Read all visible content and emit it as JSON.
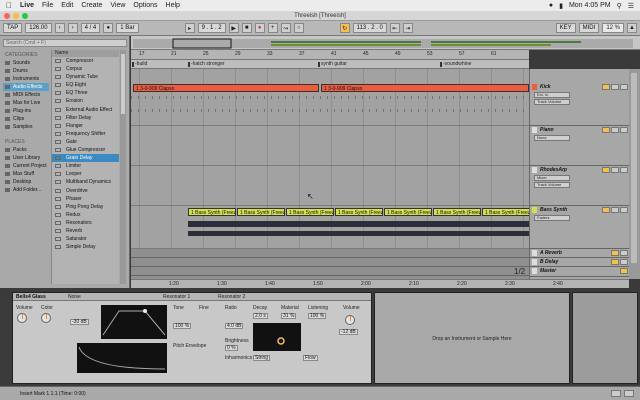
{
  "menubar": {
    "app": "Live",
    "items": [
      "File",
      "Edit",
      "Create",
      "View",
      "Options",
      "Help"
    ],
    "clock": "Mon 4:05 PM"
  },
  "window": {
    "title": "Threeish  [Threeish]"
  },
  "transport": {
    "tap": "TAP",
    "tempo": "126.00",
    "meter": "4 / 4",
    "quantize": "1 Bar",
    "position": "9 . 1 . 2",
    "loop_start": "113 . 2 . 0",
    "key_label": "KEY",
    "midi_label": "MIDI",
    "cpu": "12 %"
  },
  "browser": {
    "search_placeholder": "Search (Cmd + F)",
    "categories_heading": "CATEGORIES",
    "categories": [
      "Sounds",
      "Drums",
      "Instruments",
      "Audio Effects",
      "MIDI Effects",
      "Max for Live",
      "Plug-ins",
      "Clips",
      "Samples"
    ],
    "places_heading": "PLACES",
    "places": [
      "Packs",
      "User Library",
      "Current Project",
      "Max Stuff",
      "Desktop",
      "Add Folder..."
    ],
    "list_header": "Name",
    "items": [
      "Compressor",
      "Corpus",
      "Dynamic Tube",
      "EQ Eight",
      "EQ Three",
      "Erosion",
      "External Audio Effect",
      "Filter Delay",
      "Flanger",
      "Frequency Shifter",
      "Gate",
      "Glue Compressor",
      "Grain Delay",
      "Limiter",
      "Looper",
      "Multiband Dynamics",
      "Overdrive",
      "Phaser",
      "Ping Pong Delay",
      "Redux",
      "Resonators",
      "Reverb",
      "Saturator",
      "Simple Delay"
    ]
  },
  "arrangement": {
    "ruler_ticks": [
      "17",
      "21",
      "25",
      "29",
      "33",
      "37",
      "41",
      "45",
      "49",
      "53",
      "57",
      "61"
    ],
    "locators": [
      "-build",
      "-hatch stronger",
      "synth guitar",
      "-soundwhine"
    ],
    "drum_clips": [
      "1 3-0-909 Clapso",
      "1 3-0-909 Clapso"
    ],
    "bass_clips": [
      "1 Bass Synth (Freeze)",
      "1 Bass Synth (Freeze)",
      "1 Bass Synth (Freeze)",
      "1 Bass Synth (Freeze)",
      "1 Bass Synth (Freeze)",
      "1 Bass Synth (Freeze)",
      "1 Bass Synth (Freeze)"
    ],
    "time_ticks": [
      "1:20",
      "1:30",
      "1:40",
      "1:50",
      "2:00",
      "2:10",
      "2:20",
      "2:30",
      "2:40"
    ],
    "page_fraction": "1/2"
  },
  "tracks": [
    {
      "name": "Kick",
      "input": "Ext. In",
      "monitor": "Track Volume",
      "color": "#f25a3c"
    },
    {
      "name": "Piano",
      "input": "None",
      "monitor": "",
      "color": "#cfcfcf"
    },
    {
      "name": "RhodesArp",
      "input": "Mixer",
      "monitor": "Track Volume",
      "color": "#cfcfcf"
    },
    {
      "name": "Bass Synth",
      "input": "Faders",
      "monitor": "",
      "color": "#d4e04a"
    },
    {
      "name": "A Reverb",
      "input": "",
      "monitor": "",
      "color": "#cfcfcf"
    },
    {
      "name": "B Delay",
      "input": "",
      "monitor": "",
      "color": "#cfcfcf"
    },
    {
      "name": "Master",
      "input": "",
      "monitor": "",
      "color": "#cfcfcf"
    }
  ],
  "device": {
    "rack_title": "Bells4 Glass",
    "noise_label": "Noise",
    "osc_labels": [
      "Volume",
      "Color",
      "Tone",
      "Fine",
      "Ratio",
      "Decay",
      "Material",
      "Listening",
      "Volume"
    ],
    "values": [
      "-30 dB",
      "100 %",
      "4.0 dB",
      "0 %",
      "100 %",
      "2.0 s",
      "31 %",
      "-12 dB"
    ],
    "resonator1": "Resonator 1",
    "resonator2": "Resonator 2",
    "pitch_envelope": "Pitch Envelope",
    "brightness": "Brightness",
    "inharmonics": "Inharmonics",
    "string": "String",
    "flow": "Flow",
    "drop_text": "Drop an Instrument or Sample Here"
  },
  "status": {
    "text": "Insert Mark 1.1.1 (Time: 0:00)"
  }
}
